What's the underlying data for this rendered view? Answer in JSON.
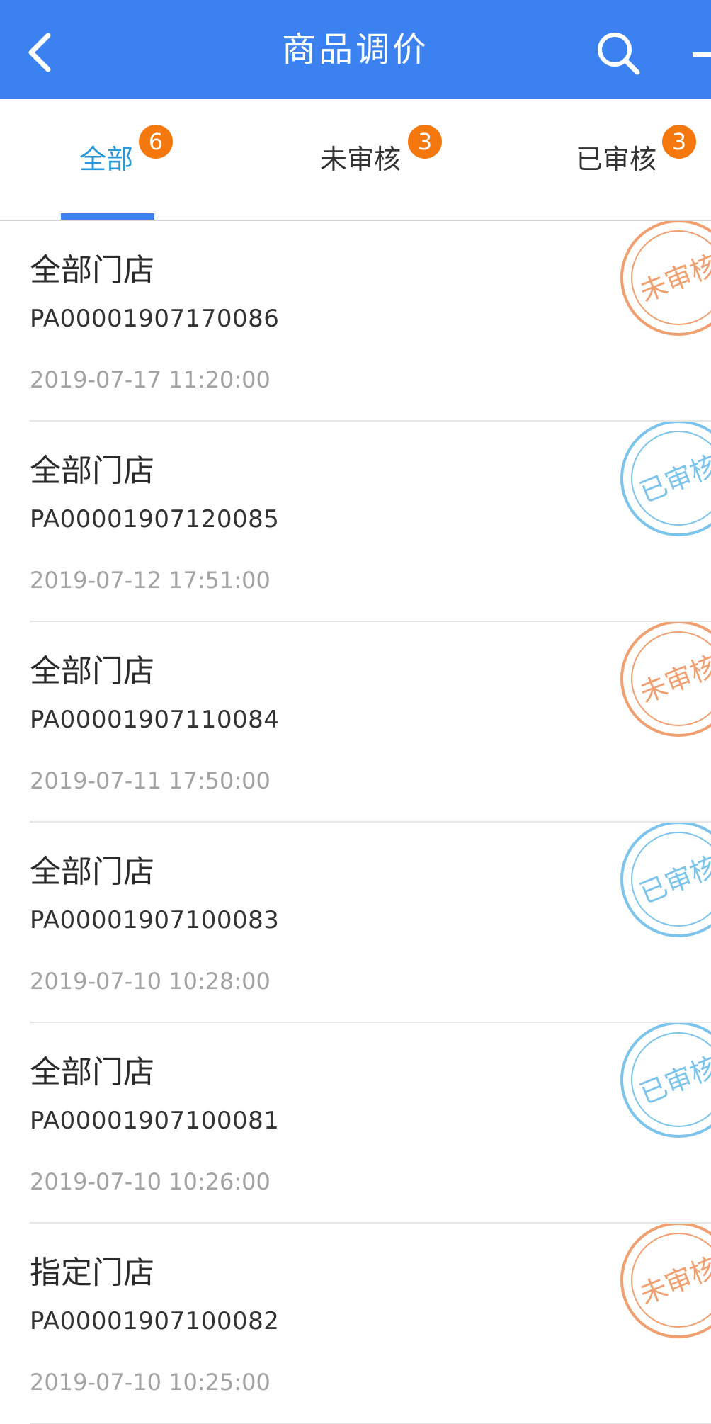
{
  "header": {
    "title": "商品调价"
  },
  "tabs": [
    {
      "label": "全部",
      "badge": "6",
      "active": true
    },
    {
      "label": "未审核",
      "badge": "3",
      "active": false
    },
    {
      "label": "已审核",
      "badge": "3",
      "active": false
    }
  ],
  "colors": {
    "header_bg": "#3b82f0",
    "tab_active": "#2a97d8",
    "badge_bg": "#f4780e",
    "stamp_unreviewed": "#f0a070",
    "stamp_reviewed": "#7cc4ec"
  },
  "list": [
    {
      "store": "全部门店",
      "order_no": "PA00001907170086",
      "time": "2019-07-17 11:20:00",
      "stamp": "未审核",
      "status": "unreviewed"
    },
    {
      "store": "全部门店",
      "order_no": "PA00001907120085",
      "time": "2019-07-12 17:51:00",
      "stamp": "已审核",
      "status": "reviewed"
    },
    {
      "store": "全部门店",
      "order_no": "PA00001907110084",
      "time": "2019-07-11 17:50:00",
      "stamp": "未审核",
      "status": "unreviewed"
    },
    {
      "store": "全部门店",
      "order_no": "PA00001907100083",
      "time": "2019-07-10 10:28:00",
      "stamp": "已审核",
      "status": "reviewed"
    },
    {
      "store": "全部门店",
      "order_no": "PA00001907100081",
      "time": "2019-07-10 10:26:00",
      "stamp": "已审核",
      "status": "reviewed"
    },
    {
      "store": "指定门店",
      "order_no": "PA00001907100082",
      "time": "2019-07-10 10:25:00",
      "stamp": "未审核",
      "status": "unreviewed"
    }
  ]
}
